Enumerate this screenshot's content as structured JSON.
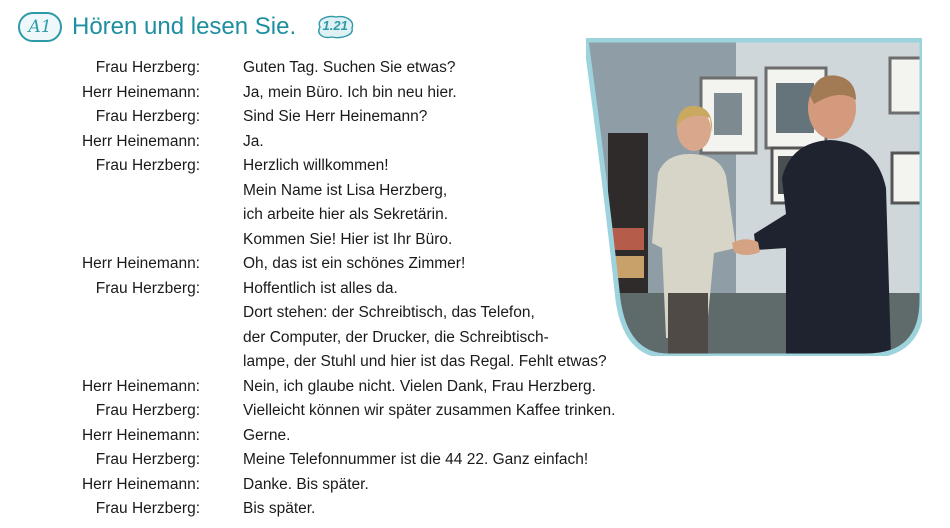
{
  "header": {
    "task_label": "A1",
    "title": "Hören und lesen Sie.",
    "track": "1.21"
  },
  "dialog": [
    {
      "speaker": "Frau Herzberg:",
      "lines": [
        "Guten Tag. Suchen Sie etwas?"
      ]
    },
    {
      "speaker": "Herr Heinemann:",
      "lines": [
        "Ja, mein Büro. Ich bin neu hier."
      ]
    },
    {
      "speaker": "Frau Herzberg:",
      "lines": [
        "Sind Sie Herr Heinemann?"
      ]
    },
    {
      "speaker": "Herr Heinemann:",
      "lines": [
        "Ja."
      ]
    },
    {
      "speaker": "Frau Herzberg:",
      "lines": [
        "Herzlich willkommen!",
        "Mein Name ist Lisa Herzberg,",
        "ich arbeite hier als Sekretärin.",
        "Kommen Sie! Hier ist Ihr Büro."
      ]
    },
    {
      "speaker": "Herr Heinemann:",
      "lines": [
        "Oh, das ist ein schönes Zimmer!"
      ]
    },
    {
      "speaker": "Frau Herzberg:",
      "lines": [
        "Hoffentlich ist alles da.",
        "Dort stehen: der Schreibtisch, das Telefon,",
        "der Computer, der Drucker, die Schreibtisch-",
        "lampe, der Stuhl und hier ist das Regal. Fehlt etwas?"
      ]
    },
    {
      "speaker": "Herr Heinemann:",
      "lines": [
        "Nein, ich glaube nicht. Vielen Dank, Frau Herzberg."
      ]
    },
    {
      "speaker": "Frau Herzberg:",
      "lines": [
        "Vielleicht können wir später zusammen Kaffee trinken."
      ]
    },
    {
      "speaker": "Herr Heinemann:",
      "lines": [
        "Gerne."
      ]
    },
    {
      "speaker": "Frau Herzberg:",
      "lines": [
        "Meine Telefonnummer ist die 44 22. Ganz einfach!"
      ]
    },
    {
      "speaker": "Herr Heinemann:",
      "lines": [
        "Danke. Bis später."
      ]
    },
    {
      "speaker": "Frau Herzberg:",
      "lines": [
        "Bis später."
      ]
    }
  ],
  "colors": {
    "accent": "#2e9aa8",
    "title": "#1e8fa0"
  }
}
